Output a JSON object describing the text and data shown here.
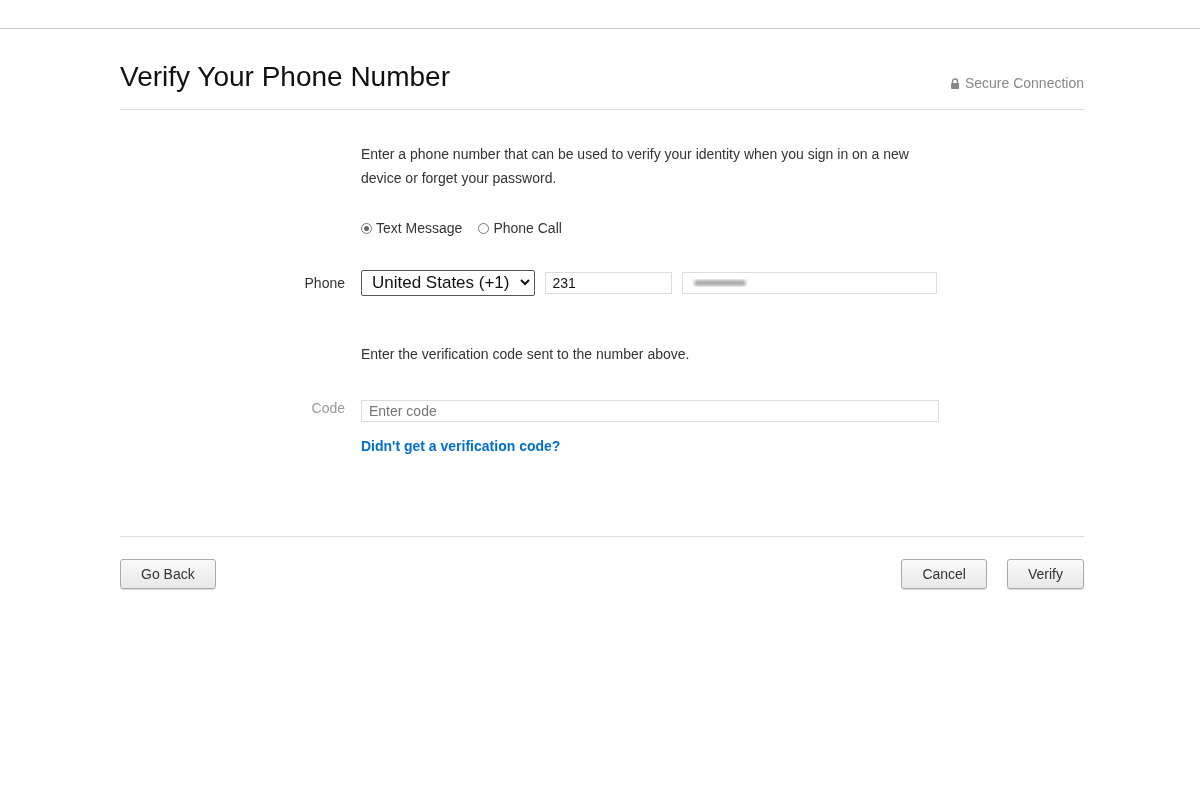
{
  "header": {
    "title": "Verify Your Phone Number",
    "secure_label": "Secure Connection"
  },
  "intro": "Enter a phone number that can be used to verify your identity when you sign in on a new device or forget your password.",
  "methods": [
    {
      "label": "Text Message",
      "selected": true
    },
    {
      "label": "Phone Call",
      "selected": false
    }
  ],
  "phone": {
    "label": "Phone",
    "country": "United States (+1)",
    "area_code": "231"
  },
  "code_prompt": "Enter the verification code sent to the number above.",
  "code": {
    "label": "Code",
    "placeholder": "Enter code"
  },
  "resend_link": "Didn't get a verification code?",
  "footer": {
    "back": "Go Back",
    "cancel": "Cancel",
    "verify": "Verify"
  }
}
